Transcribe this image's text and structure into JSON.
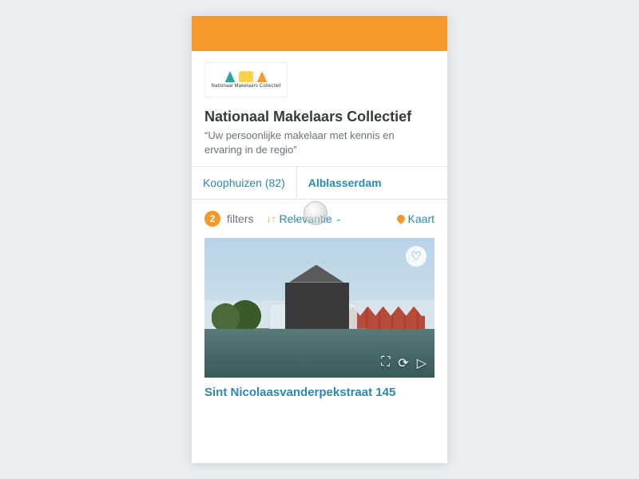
{
  "brand": {
    "logo_caption": "Nationaal Makelaars Collectief",
    "accent_color": "#f39a2a",
    "link_color": "#2b88af"
  },
  "company": {
    "name": "Nationaal Makelaars Collectief",
    "tagline": "“Uw persoonlijke makelaar met kennis en ervaring in de regio”"
  },
  "tabs": [
    {
      "label": "Koophuizen (82)",
      "active": false
    },
    {
      "label": "Alblasserdam",
      "active": true
    }
  ],
  "toolbar": {
    "filter_count": "2",
    "filter_label": "filters",
    "sort_label": "Relevantie",
    "map_label": "Kaart"
  },
  "listing": {
    "title": "Sint Nicolaasvanderpekstraat 145"
  }
}
